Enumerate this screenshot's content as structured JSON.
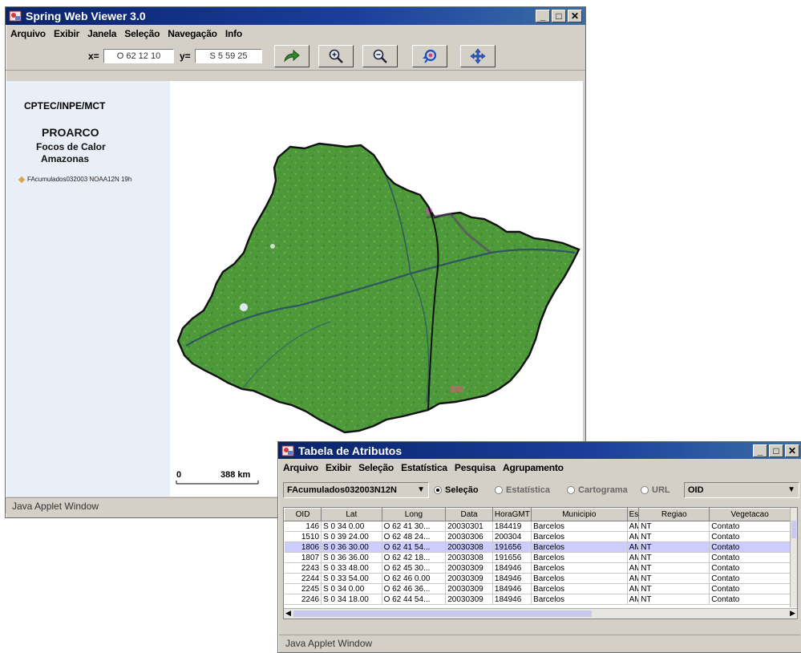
{
  "viewer": {
    "title": "Spring Web Viewer 3.0",
    "menu": [
      "Arquivo",
      "Exibir",
      "Janela",
      "Seleção",
      "Navegação",
      "Info"
    ],
    "x_label": "x=",
    "x_value": "O 62 12 10",
    "y_label": "y=",
    "y_value": "S 5 59 25",
    "tool_icons": [
      "redraw-arrow-icon",
      "zoom-in-icon",
      "zoom-out-icon",
      "zoom-previous-icon",
      "pan-icon"
    ],
    "org": "CPTEC/INPE/MCT",
    "project": "PROARCO",
    "subtitle1": "Focos de Calor",
    "subtitle2": "Amazonas",
    "layer": "FAcumulados032003 NOAA12N 19h",
    "scale_zero": "0",
    "scale_km": "388 km",
    "status": "Java Applet Window"
  },
  "table_window": {
    "title": "Tabela de Atributos",
    "menu": [
      "Arquivo",
      "Exibir",
      "Seleção",
      "Estatística",
      "Pesquisa",
      "Agrupamento"
    ],
    "layer_select": "FAcumulados032003N12N",
    "radios": [
      {
        "label": "Seleção",
        "checked": true
      },
      {
        "label": "Estatística",
        "checked": false
      },
      {
        "label": "Cartograma",
        "checked": false
      },
      {
        "label": "URL",
        "checked": false
      }
    ],
    "field_select": "OID",
    "columns": [
      "OID",
      "Lat",
      "Long",
      "Data",
      "HoraGMT",
      "Municipio",
      "Es",
      "Regiao",
      "Vegetacao"
    ],
    "rows": [
      [
        "146",
        "S 0 34 0.00",
        "O 62 41 30...",
        "20030301",
        "184419",
        "Barcelos",
        "AM",
        "NT",
        "Contato"
      ],
      [
        "1510",
        "S 0 39 24.00",
        "O 62 48 24...",
        "20030306",
        "200304",
        "Barcelos",
        "AM",
        "NT",
        "Contato"
      ],
      [
        "1806",
        "S 0 36 30.00",
        "O 62 41 54...",
        "20030308",
        "191656",
        "Barcelos",
        "AM",
        "NT",
        "Contato"
      ],
      [
        "1807",
        "S 0 36 36.00",
        "O 62 42 18...",
        "20030308",
        "191656",
        "Barcelos",
        "AM",
        "NT",
        "Contato"
      ],
      [
        "2243",
        "S 0 33 48.00",
        "O 62 45 30...",
        "20030309",
        "184946",
        "Barcelos",
        "AM",
        "NT",
        "Contato"
      ],
      [
        "2244",
        "S 0 33 54.00",
        "O 62 46 0.00",
        "20030309",
        "184946",
        "Barcelos",
        "AM",
        "NT",
        "Contato"
      ],
      [
        "2245",
        "S 0 34 0.00",
        "O 62 46 36...",
        "20030309",
        "184946",
        "Barcelos",
        "AM",
        "NT",
        "Contato"
      ],
      [
        "2246",
        "S 0 34 18.00",
        "O 62 44 54...",
        "20030309",
        "184946",
        "Barcelos",
        "AM",
        "NT",
        "Contato"
      ]
    ],
    "selected_row": 2,
    "status": "Java Applet Window"
  }
}
